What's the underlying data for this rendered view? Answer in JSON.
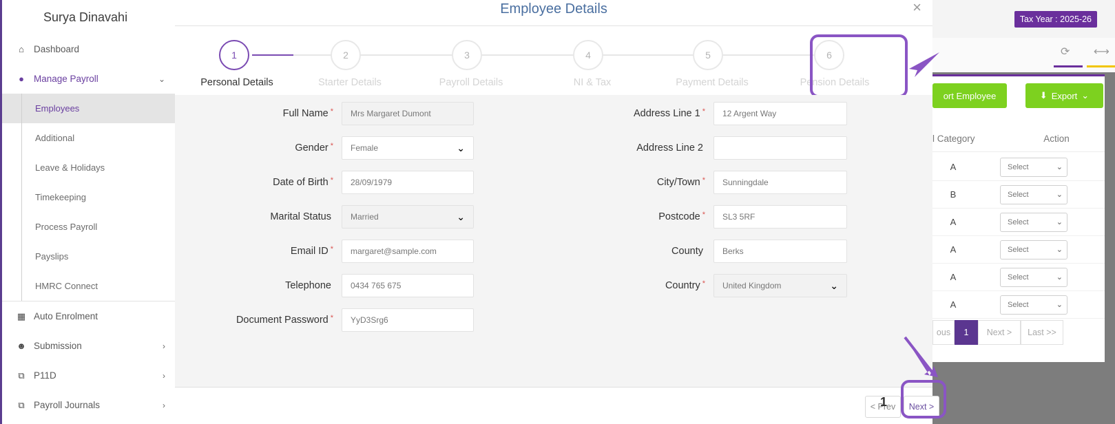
{
  "sidebar": {
    "user_name": "Surya Dinavahi",
    "items": [
      {
        "label": "Dashboard",
        "icon": "home-icon"
      },
      {
        "label": "Manage Payroll",
        "icon": "user-icon"
      },
      {
        "label": "Auto Enrolment",
        "icon": "grid-icon"
      },
      {
        "label": "Submission",
        "icon": "users-icon"
      },
      {
        "label": "P11D",
        "icon": "copy-icon"
      },
      {
        "label": "Payroll Journals",
        "icon": "copy-icon"
      }
    ],
    "sub_items": [
      "Employees",
      "Additional",
      "Leave & Holidays",
      "Timekeeping",
      "Process Payroll",
      "Payslips",
      "HMRC Connect"
    ]
  },
  "right_panel": {
    "tax_year": "Tax Year : 2025-26",
    "import_label": "ort Employee",
    "export_label": "Export",
    "table_headers": [
      "l Category",
      "Action"
    ],
    "rows": [
      {
        "category": "A",
        "action": "Select"
      },
      {
        "category": "B",
        "action": "Select"
      },
      {
        "category": "A",
        "action": "Select"
      },
      {
        "category": "A",
        "action": "Select"
      },
      {
        "category": "A",
        "action": "Select"
      },
      {
        "category": "A",
        "action": "Select"
      }
    ],
    "pager": {
      "prev": "ous",
      "current": "1",
      "next": "Next >",
      "last": "Last >>"
    }
  },
  "modal": {
    "title": "Employee Details",
    "close": "×",
    "steps": [
      {
        "num": "1",
        "label": "Personal Details"
      },
      {
        "num": "2",
        "label": "Starter Details"
      },
      {
        "num": "3",
        "label": "Payroll Details"
      },
      {
        "num": "4",
        "label": "NI & Tax"
      },
      {
        "num": "5",
        "label": "Payment Details"
      },
      {
        "num": "6",
        "label": "Pension Details"
      }
    ],
    "active_step": 1,
    "form_left": [
      {
        "label": "Full Name",
        "value": "Mrs Margaret Dumont",
        "required": "*",
        "readonly": true,
        "dropdown": false
      },
      {
        "label": "Gender",
        "value": "Female",
        "required": "*",
        "readonly": false,
        "dropdown": true
      },
      {
        "label": "Date of Birth",
        "value": "28/09/1979",
        "required": "*",
        "readonly": false,
        "dropdown": false
      },
      {
        "label": "Marital Status",
        "value": "Married",
        "required": "",
        "readonly": true,
        "dropdown": true
      },
      {
        "label": "Email ID",
        "value": "margaret@sample.com",
        "required": "*",
        "readonly": false,
        "dropdown": false
      },
      {
        "label": "Telephone",
        "value": "0434 765 675",
        "required": "",
        "readonly": false,
        "dropdown": false
      },
      {
        "label": "Document Password",
        "value": "YyD3Srg6",
        "required": "*",
        "readonly": false,
        "dropdown": false
      }
    ],
    "form_right": [
      {
        "label": "Address Line 1",
        "value": "12 Argent Way",
        "required": "*",
        "readonly": false,
        "dropdown": false
      },
      {
        "label": "Address Line 2",
        "value": "",
        "required": "",
        "readonly": false,
        "dropdown": false
      },
      {
        "label": "City/Town",
        "value": "Sunningdale",
        "required": "*",
        "readonly": false,
        "dropdown": false
      },
      {
        "label": "Postcode",
        "value": "SL3 5RF",
        "required": "*",
        "readonly": false,
        "dropdown": false
      },
      {
        "label": "County",
        "value": "Berks",
        "required": "",
        "readonly": false,
        "dropdown": false
      },
      {
        "label": "Country",
        "value": "United Kingdom",
        "required": "*",
        "readonly": false,
        "dropdown": true
      }
    ],
    "footer": {
      "prev": "< Prev",
      "next": "Next >",
      "marker": "1"
    }
  },
  "colors": {
    "accent": "#7a4ab2",
    "brand": "#6a2f9c",
    "green": "#7dd11f",
    "yellow": "#f2c500",
    "required": "#d9534f"
  }
}
